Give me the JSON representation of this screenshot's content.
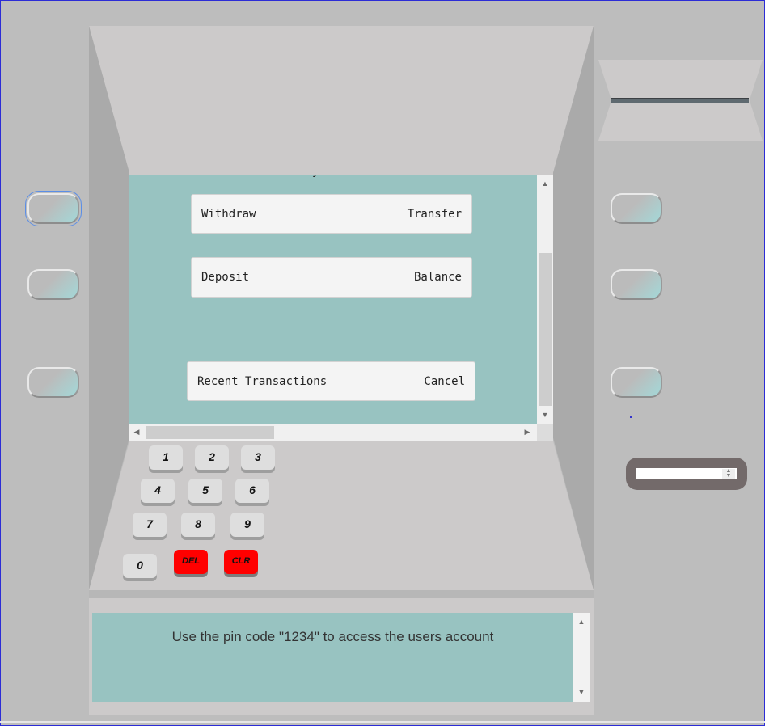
{
  "menu": {
    "row1": {
      "left": "Withdraw",
      "right": "Transfer"
    },
    "row2": {
      "left": "Deposit",
      "right": "Balance"
    },
    "row3": {
      "left": "Recent Transactions",
      "right": "Cancel"
    },
    "cut_text": "y"
  },
  "keypad": {
    "keys": [
      "1",
      "2",
      "3",
      "4",
      "5",
      "6",
      "7",
      "8",
      "9",
      "0"
    ],
    "del_label": "DEL",
    "clr_label": "CLR"
  },
  "message": "Use the pin code \"1234\" to access the users account",
  "colors": {
    "screen": "#98c3c1",
    "housing": "#cccaca",
    "key_red": "#ff0000",
    "focus": "#5b8ee6"
  },
  "icons": [
    "scroll-up-icon",
    "scroll-down-icon",
    "scroll-left-icon",
    "scroll-right-icon",
    "spin-updown-icon"
  ]
}
